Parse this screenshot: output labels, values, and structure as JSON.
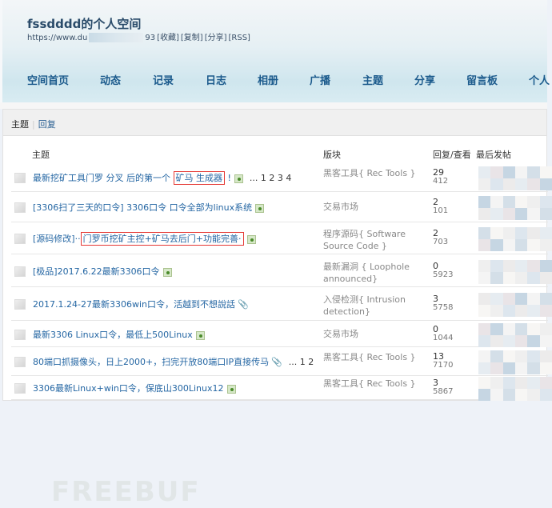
{
  "header": {
    "title": "fssdddd的个人空间",
    "url_start": "https://www.du",
    "url_end": "93",
    "links": [
      "[收藏]",
      "[复制]",
      "[分享]",
      "[RSS]"
    ]
  },
  "nav": [
    "空间首页",
    "动态",
    "记录",
    "日志",
    "相册",
    "广播",
    "主题",
    "分享",
    "留言板",
    "个人"
  ],
  "tabs": {
    "active": "主题",
    "other": "回复"
  },
  "columns": {
    "topic": "主题",
    "section": "版块",
    "counts": "回复/查看",
    "last": "最后发帖"
  },
  "rows": [
    {
      "pre": "最新挖矿工具门罗 分叉 后的第一个 ",
      "hl": "矿马 生成器",
      "post": " !",
      "icon": "image",
      "pages": "... 1 2 3 4",
      "section": "黑客工具{ Rec Tools }",
      "replies": "29",
      "views": "412"
    },
    {
      "pre": "[3306扫了三天的口令] 3306口令 口令全部为linux系统",
      "hl": "",
      "post": "",
      "icon": "image",
      "pages": "",
      "section": "交易市场",
      "replies": "2",
      "views": "101"
    },
    {
      "pre": "[源码修改]··",
      "hl": "门罗币挖矿主控+矿马去后门+功能完善·",
      "post": "",
      "icon": "image",
      "pages": "",
      "section": "程序源码{ Software Source Code }",
      "replies": "2",
      "views": "703"
    },
    {
      "pre": "[极品]2017.6.22最新3306口令",
      "hl": "",
      "post": "",
      "icon": "image",
      "pages": "",
      "section": "最新漏洞 { Loophole announced}",
      "replies": "0",
      "views": "5923"
    },
    {
      "pre": "2017.1.24-27最新3306win口令，活越到不想說話",
      "hl": "",
      "post": "",
      "icon": "attachment",
      "pages": "",
      "section": "入侵检测{ Intrusion detection}",
      "replies": "3",
      "views": "5758"
    },
    {
      "pre": "最新3306 Linux口令，最低上500Linux",
      "hl": "",
      "post": "",
      "icon": "image",
      "pages": "",
      "section": "交易市场",
      "replies": "0",
      "views": "1044"
    },
    {
      "pre": "80端口抓摄像头，日上2000+，扫完开放80端口IP直接传马",
      "hl": "",
      "post": "",
      "icon": "attachment",
      "pages": "... 1 2",
      "section": "黑客工具{ Rec Tools }",
      "replies": "13",
      "views": "7170"
    },
    {
      "pre": "3306最新Linux+win口令，保底山300Linux12",
      "hl": "",
      "post": "",
      "icon": "image",
      "pages": "",
      "section": "黑客工具{ Rec Tools }",
      "replies": "3",
      "views": "5867"
    }
  ],
  "watermark": "FREEBUF"
}
